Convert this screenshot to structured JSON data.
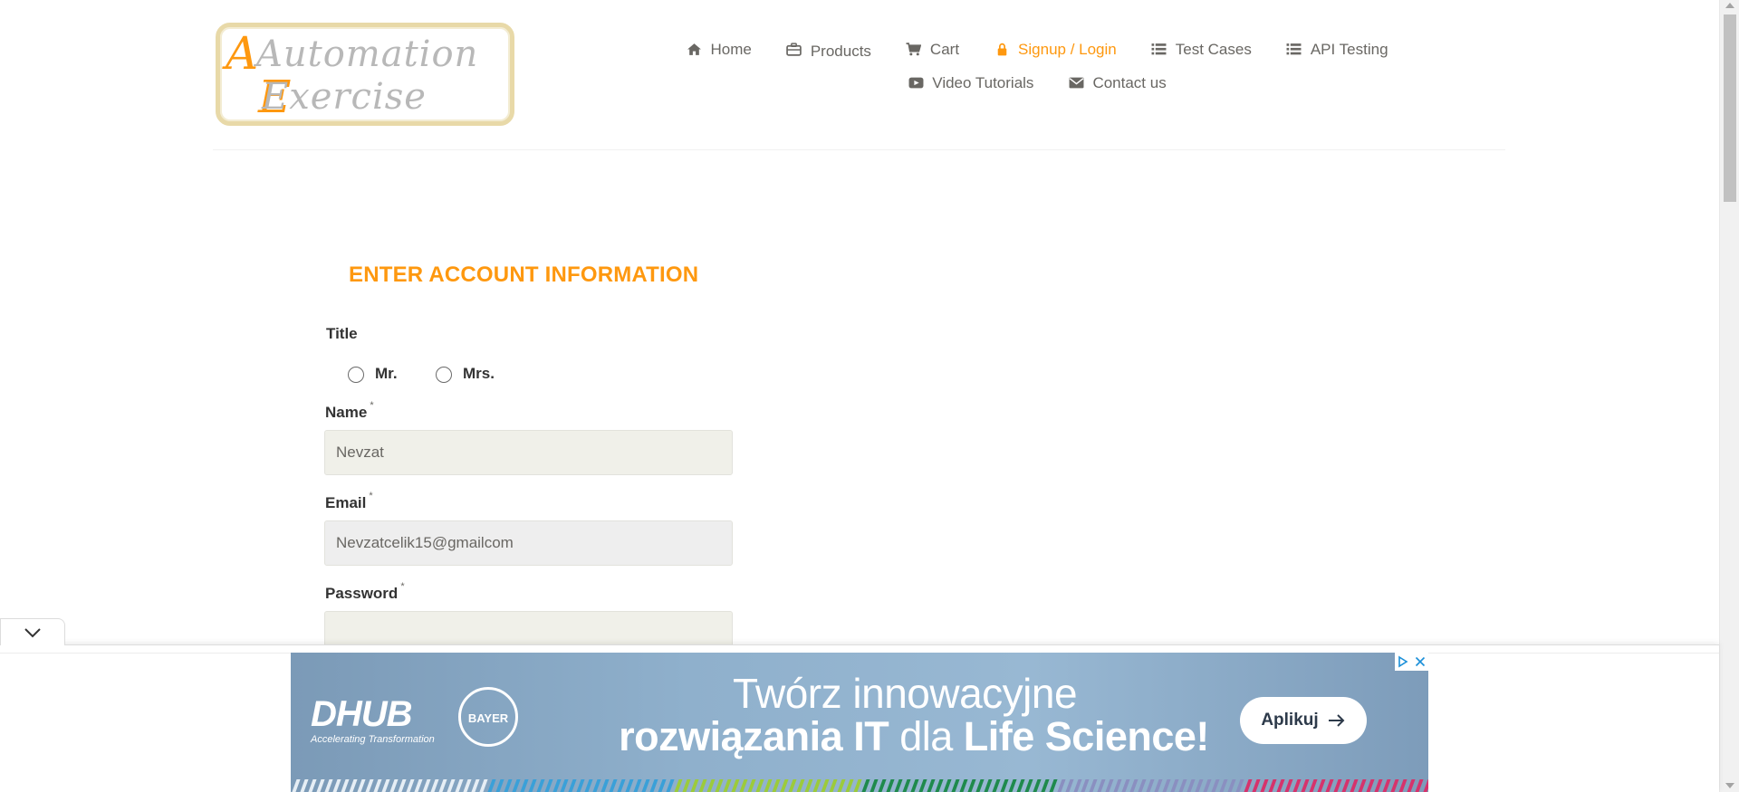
{
  "logo": {
    "text_line1": "Automation",
    "text_line2": "Exercise"
  },
  "nav": {
    "items": [
      {
        "label": "Home",
        "icon": "home-icon"
      },
      {
        "label": "Products",
        "icon": "briefcase-icon"
      },
      {
        "label": "Cart",
        "icon": "shopping-cart-icon"
      },
      {
        "label": "Signup / Login",
        "icon": "lock-icon",
        "active": true
      },
      {
        "label": "Test Cases",
        "icon": "list-icon"
      },
      {
        "label": "API Testing",
        "icon": "list-icon"
      },
      {
        "label": "Video Tutorials",
        "icon": "youtube-play-icon"
      },
      {
        "label": "Contact us",
        "icon": "envelope-icon"
      }
    ],
    "active_color": "#FE980F"
  },
  "form": {
    "title": "ENTER ACCOUNT INFORMATION",
    "title_label": "Title",
    "options": {
      "mr": "Mr.",
      "mrs": "Mrs."
    },
    "name": {
      "label": "Name",
      "required_mark": "*",
      "value": "Nevzat"
    },
    "email": {
      "label": "Email",
      "required_mark": "*",
      "value": "Nevzatcelik15@gmailcom"
    },
    "password": {
      "label": "Password",
      "required_mark": "*",
      "value": ""
    }
  },
  "ad": {
    "brand": "DHUB",
    "brand_tagline": "Accelerating Transformation",
    "partner": "BAYER",
    "headline_line1": "Twórz innowacyjne",
    "headline_line2_bold_a": "rozwiązania IT",
    "headline_line2_thin": "dla",
    "headline_line2_bold_b": "Life Science!",
    "cta_label": "Aplikuj"
  },
  "colors": {
    "accent": "#FE980F",
    "input_bg": "#F0F0E9",
    "text": "#696763"
  }
}
